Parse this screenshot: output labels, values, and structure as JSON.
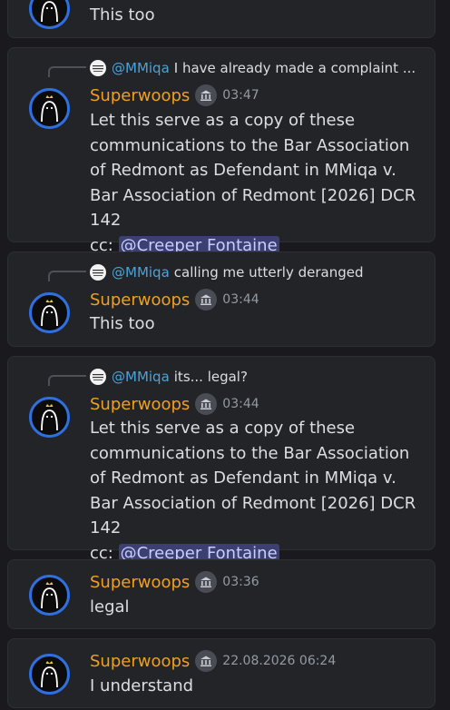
{
  "messages": [
    {
      "text": "This too"
    },
    {
      "reply": {
        "author": "@MMiqa",
        "text": "I have already made a complaint ..."
      },
      "author": "Superwoops",
      "time": "03:47",
      "text": "Let this serve as a copy of these communications to the Bar Association of Redmont as Defendant in MMiqa v. Bar Association of Redmont [2026] DCR 142",
      "cc_label": "cc:",
      "mention": "@Creeper Fontaine"
    },
    {
      "reply": {
        "author": "@MMiqa",
        "text": "calling me utterly deranged"
      },
      "author": "Superwoops",
      "time": "03:44",
      "text": "This too"
    },
    {
      "reply": {
        "author": "@MMiqa",
        "text": "its... legal?"
      },
      "author": "Superwoops",
      "time": "03:44",
      "text": "Let this serve as a copy of these communications to the Bar Association of Redmont as Defendant in MMiqa v. Bar Association of Redmont [2026] DCR 142",
      "cc_label": "cc:",
      "mention": "@Creeper Fontaine"
    },
    {
      "author": "Superwoops",
      "time": "03:36",
      "text": "legal"
    },
    {
      "author": "Superwoops",
      "time": "22.08.2026 06:24",
      "text": "I understand"
    }
  ],
  "icons": {
    "avatar": "ghost-avatar-icon",
    "badge": "bank-building-icon",
    "reply_avatar": "mini-avatar-icon"
  },
  "colors": {
    "author": "#f0a020",
    "reply_author": "#4aa3d8",
    "mention_bg": "#3b3f72",
    "avatar_ring": "#2f6fe0"
  }
}
